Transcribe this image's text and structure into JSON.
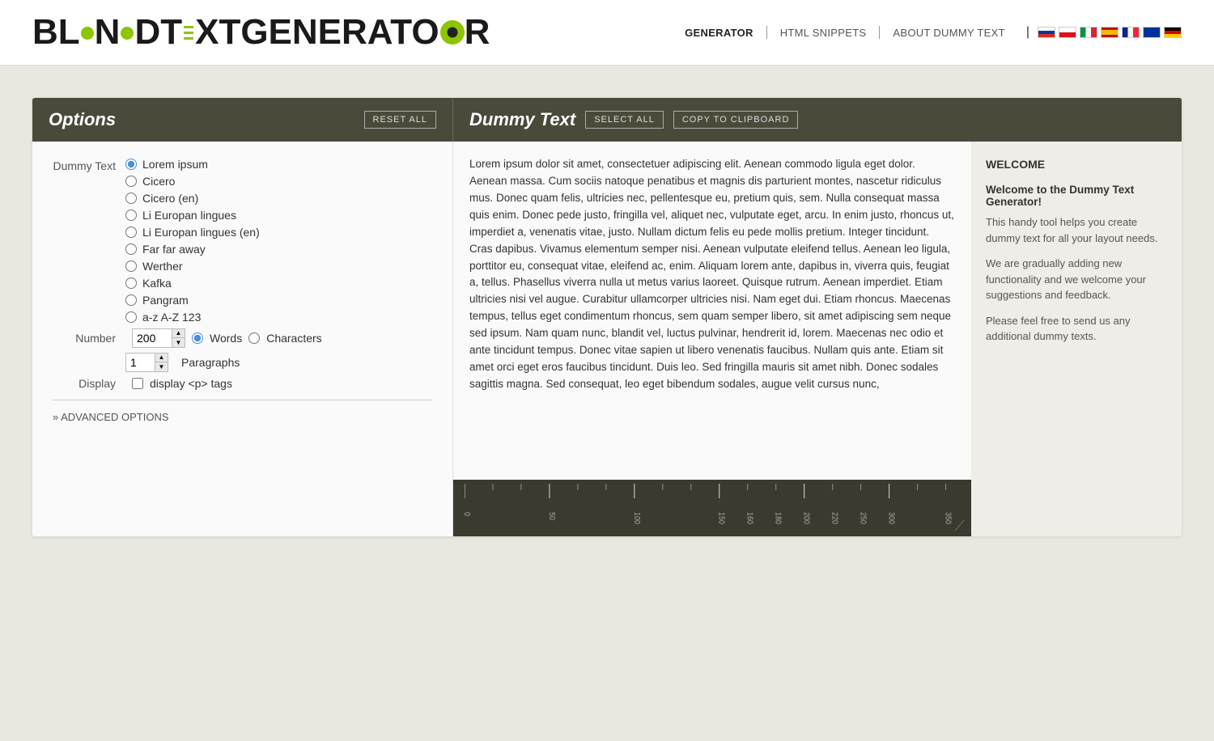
{
  "header": {
    "logo_text": "BL•NDTEXTGENERATOR",
    "nav": [
      {
        "id": "generator",
        "label": "GENERATOR",
        "active": true
      },
      {
        "id": "html-snippets",
        "label": "HTML SNIPPETS",
        "active": false
      },
      {
        "id": "about",
        "label": "ABOUT DUMMY TEXT",
        "active": false
      }
    ]
  },
  "options_panel": {
    "title": "Options",
    "reset_btn": "RESET ALL",
    "dummy_title": "Dummy Text",
    "select_all_btn": "SELECT ALL",
    "copy_btn": "COPY TO CLIPBOARD"
  },
  "dummy_text_options": {
    "label": "Dummy Text",
    "choices": [
      {
        "id": "lorem",
        "label": "Lorem ipsum",
        "selected": true
      },
      {
        "id": "cicero",
        "label": "Cicero",
        "selected": false
      },
      {
        "id": "cicero-en",
        "label": "Cicero (en)",
        "selected": false
      },
      {
        "id": "li-europan",
        "label": "Li Europan lingues",
        "selected": false
      },
      {
        "id": "li-europan-en",
        "label": "Li Europan lingues (en)",
        "selected": false
      },
      {
        "id": "far-away",
        "label": "Far far away",
        "selected": false
      },
      {
        "id": "werther",
        "label": "Werther",
        "selected": false
      },
      {
        "id": "kafka",
        "label": "Kafka",
        "selected": false
      },
      {
        "id": "pangram",
        "label": "Pangram",
        "selected": false
      },
      {
        "id": "a-z",
        "label": "a-z A-Z 123",
        "selected": false
      }
    ]
  },
  "number_options": {
    "label": "Number",
    "value": "200",
    "type_words_label": "Words",
    "type_chars_label": "Characters",
    "paragraphs_value": "1",
    "paragraphs_label": "Paragraphs"
  },
  "display_options": {
    "label": "Display",
    "checkbox_label": "display <p> tags",
    "checked": false
  },
  "advanced": {
    "label": "» ADVANCED OPTIONS"
  },
  "dummy_text": {
    "content": "Lorem ipsum dolor sit amet, consectetuer adipiscing elit. Aenean commodo ligula eget dolor. Aenean massa. Cum sociis natoque penatibus et magnis dis parturient montes, nascetur ridiculus mus. Donec quam felis, ultricies nec, pellentesque eu, pretium quis, sem. Nulla consequat massa quis enim. Donec pede justo, fringilla vel, aliquet nec, vulputate eget, arcu. In enim justo, rhoncus ut, imperdiet a, venenatis vitae, justo. Nullam dictum felis eu pede mollis pretium. Integer tincidunt. Cras dapibus. Vivamus elementum semper nisi. Aenean vulputate eleifend tellus. Aenean leo ligula, porttitor eu, consequat vitae, eleifend ac, enim. Aliquam lorem ante, dapibus in, viverra quis, feugiat a, tellus. Phasellus viverra nulla ut metus varius laoreet. Quisque rutrum. Aenean imperdiet. Etiam ultricies nisi vel augue. Curabitur ullamcorper ultricies nisi. Nam eget dui. Etiam rhoncus. Maecenas tempus, tellus eget condimentum rhoncus, sem quam semper libero, sit amet adipiscing sem neque sed ipsum. Nam quam nunc, blandit vel, luctus pulvinar, hendrerit id, lorem. Maecenas nec odio et ante tincidunt tempus. Donec vitae sapien ut libero venenatis faucibus. Nullam quis ante. Etiam sit amet orci eget eros faucibus tincidunt. Duis leo. Sed fringilla mauris sit amet nibh. Donec sodales sagittis magna. Sed consequat, leo eget bibendum sodales, augue velit cursus nunc,"
  },
  "ruler": {
    "labels": [
      "0",
      "50",
      "100",
      "150",
      "160",
      "180",
      "200",
      "220",
      "250",
      "300",
      "350"
    ]
  },
  "welcome": {
    "title": "WELCOME",
    "subtitle": "Welcome to the Dummy Text Generator!",
    "paragraphs": [
      "This handy tool helps you create dummy text for all your layout needs.",
      "We are gradually adding new functionality and we welcome your suggestions and feedback.",
      "Please feel free to send us any additional dummy texts."
    ]
  }
}
